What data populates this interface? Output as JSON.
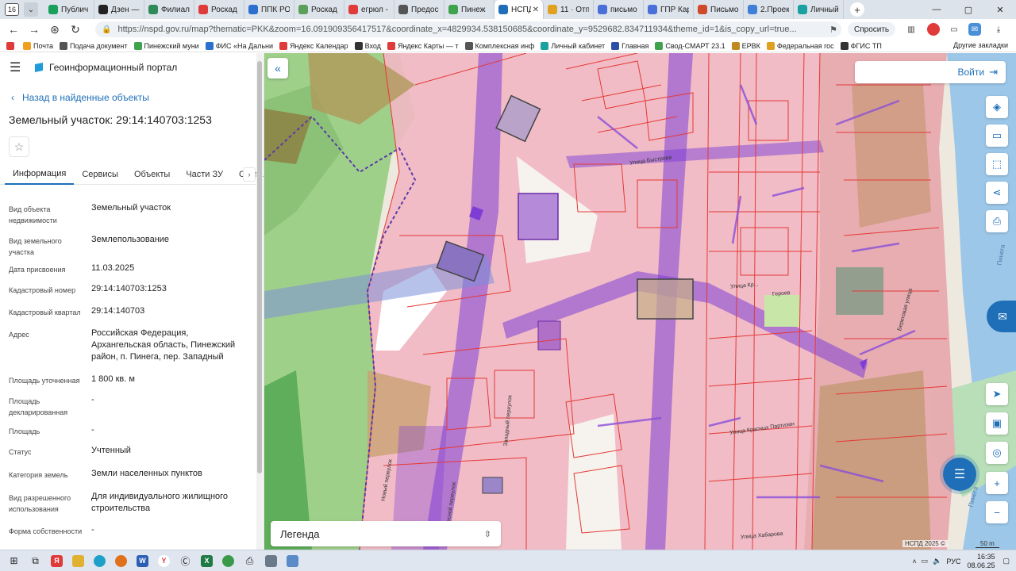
{
  "browser": {
    "tab_count": "16",
    "tabs": [
      {
        "label": "Публич",
        "color": "#1a9f5c"
      },
      {
        "label": "Дзен —",
        "color": "#222222"
      },
      {
        "label": "Филиал",
        "color": "#2e8b57"
      },
      {
        "label": "Роскад",
        "color": "#e03b3b"
      },
      {
        "label": "ППК РО",
        "color": "#2c6fcf"
      },
      {
        "label": "Роскад",
        "color": "#5aa05a"
      },
      {
        "label": "егрюл -",
        "color": "#e03b3b"
      },
      {
        "label": "Предос",
        "color": "#555555"
      },
      {
        "label": "Пинеж",
        "color": "#3fa34d"
      },
      {
        "label": "НСПД",
        "color": "#1e6fb8",
        "active": true
      },
      {
        "label": "11 · Отп",
        "color": "#e0a020"
      },
      {
        "label": "письмо",
        "color": "#4a6fd8"
      },
      {
        "label": "ГПР Кар",
        "color": "#4a6fd8"
      },
      {
        "label": "Письмо",
        "color": "#d04a2a"
      },
      {
        "label": "2.Проек",
        "color": "#3f7fd8"
      },
      {
        "label": "Личный",
        "color": "#1aa0a0"
      }
    ],
    "url": "https://nspd.gov.ru/map?thematic=PKK&zoom=16.091909356417517&coordinate_x=4829934.538150685&coordinate_y=9529682.834711934&theme_id=1&is_copy_url=true...",
    "ask_label": "Спросить",
    "bookmarks": [
      {
        "label": "",
        "color": "#e03b3b"
      },
      {
        "label": "Почта",
        "color": "#f0a020"
      },
      {
        "label": "Подача документ",
        "color": "#555555"
      },
      {
        "label": "Пинежский муни",
        "color": "#3fa34d"
      },
      {
        "label": "ФИС «На Дальни",
        "color": "#2c6fcf"
      },
      {
        "label": "Яндекс Календар",
        "color": "#e03b3b"
      },
      {
        "label": "Вход",
        "color": "#333333"
      },
      {
        "label": "Яндекс Карты — т",
        "color": "#e03b3b"
      },
      {
        "label": "Комплексная инф",
        "color": "#555555"
      },
      {
        "label": "Личный кабинет",
        "color": "#1aa0a0"
      },
      {
        "label": "Главная",
        "color": "#2c4fa8"
      },
      {
        "label": "Свод-СМАРТ 23.1",
        "color": "#3fa34d"
      },
      {
        "label": "ЕРВК",
        "color": "#c08a20"
      },
      {
        "label": "Федеральная гос",
        "color": "#e0a020"
      },
      {
        "label": "ФГИС ТП",
        "color": "#333333"
      }
    ],
    "bookmarks_more": "Другие закладки"
  },
  "panel": {
    "portal_title": "Геоинформационный портал",
    "back_label": "Назад в найденные объекты",
    "object_title": "Земельный участок: 29:14:140703:1253",
    "tabs": [
      "Информация",
      "Сервисы",
      "Объекты",
      "Части ЗУ",
      "Соста"
    ],
    "properties": [
      {
        "key": "Вид объекта недвижимости",
        "value": "Земельный участок"
      },
      {
        "key": "Вид земельного участка",
        "value": "Землепользование"
      },
      {
        "key": "Дата присвоения",
        "value": "11.03.2025"
      },
      {
        "key": "Кадастровый номер",
        "value": "29:14:140703:1253"
      },
      {
        "key": "Кадастровый квартал",
        "value": "29:14:140703"
      },
      {
        "key": "Адрес",
        "value": "Российская Федерация, Архангельская область, Пинежский район, п. Пинега, пер. Западный"
      },
      {
        "key": "Площадь уточненная",
        "value": "1 800 кв. м"
      },
      {
        "key": "Площадь декларированная",
        "value": "-"
      },
      {
        "key": "Площадь",
        "value": "-"
      },
      {
        "key": "Статус",
        "value": "Учтенный"
      },
      {
        "key": "Категория земель",
        "value": "Земли населенных пунктов"
      },
      {
        "key": "Вид разрешенного использования",
        "value": "Для индивидуального жилищного строительства"
      },
      {
        "key": "Форма собственности",
        "value": "-"
      }
    ]
  },
  "map": {
    "login_label": "Войти",
    "legend_label": "Легенда",
    "copyright": "НСПД 2025 ©",
    "scale": "50 m",
    "streets": [
      {
        "label": "Улица Быстрова"
      },
      {
        "label": "Улица Кр..."
      },
      {
        "label": "Героев"
      },
      {
        "label": "Улица Красных Партизан"
      },
      {
        "label": "Западный переулок"
      },
      {
        "label": "Лесной переулок"
      },
      {
        "label": "Новый переулок"
      },
      {
        "label": "Улица Хабарова"
      },
      {
        "label": "Береговая улица"
      },
      {
        "label": "Пинега"
      },
      {
        "label": "Пинега"
      }
    ],
    "colors": {
      "parcel": "#e53935",
      "zone_purple": "#7e3ed6",
      "forest": "#9fd08a",
      "river": "#9cc7e8",
      "accent": "#1e6fb8"
    }
  },
  "taskbar": {
    "lang": "РУС",
    "time": "16:35",
    "date": "08.06.25"
  }
}
